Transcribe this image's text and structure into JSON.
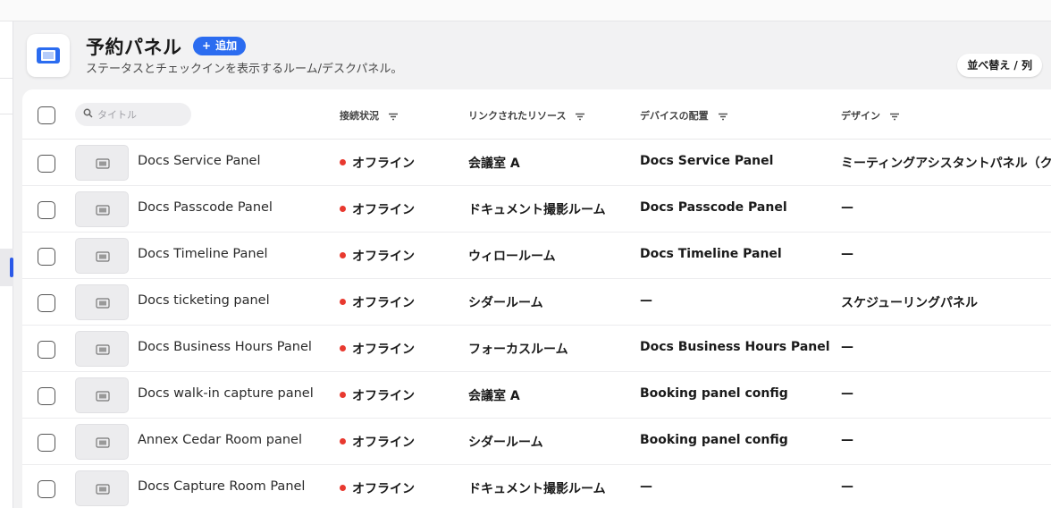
{
  "header": {
    "title": "予約パネル",
    "add_label": "追加",
    "subtitle": "ステータスとチェックインを表示するルーム/デスクパネル。",
    "sort_label": "並べ替え / 列"
  },
  "search": {
    "placeholder": "タイトル"
  },
  "columns": {
    "status": "接続状況",
    "resource": "リンクされたリソース",
    "device": "デバイスの配置",
    "design": "デザイン"
  },
  "colors": {
    "accent": "#2b6cf0",
    "offline": "#e8392f"
  },
  "rows": [
    {
      "name": "Docs Service Panel",
      "status": "オフライン",
      "resource": "会議室 A",
      "device": "Docs Service Panel",
      "design": "ミーティングアシスタントパネル（ク"
    },
    {
      "name": "Docs Passcode Panel",
      "status": "オフライン",
      "resource": "ドキュメント撮影ルーム",
      "device": "Docs Passcode Panel",
      "design": "—"
    },
    {
      "name": "Docs Timeline Panel",
      "status": "オフライン",
      "resource": "ウィロールーム",
      "device": "Docs Timeline Panel",
      "design": "—"
    },
    {
      "name": "Docs ticketing panel",
      "status": "オフライン",
      "resource": "シダールーム",
      "device": "—",
      "design": "スケジューリングパネル"
    },
    {
      "name": "Docs Business Hours Panel",
      "status": "オフライン",
      "resource": "フォーカスルーム",
      "device": "Docs Business Hours Panel",
      "design": "—"
    },
    {
      "name": "Docs walk-in capture panel",
      "status": "オフライン",
      "resource": "会議室 A",
      "device": "Booking panel config",
      "design": "—"
    },
    {
      "name": "Annex Cedar Room panel",
      "status": "オフライン",
      "resource": "シダールーム",
      "device": "Booking panel config",
      "design": "—"
    },
    {
      "name": "Docs Capture Room Panel",
      "status": "オフライン",
      "resource": "ドキュメント撮影ルーム",
      "device": "—",
      "design": "—"
    }
  ]
}
